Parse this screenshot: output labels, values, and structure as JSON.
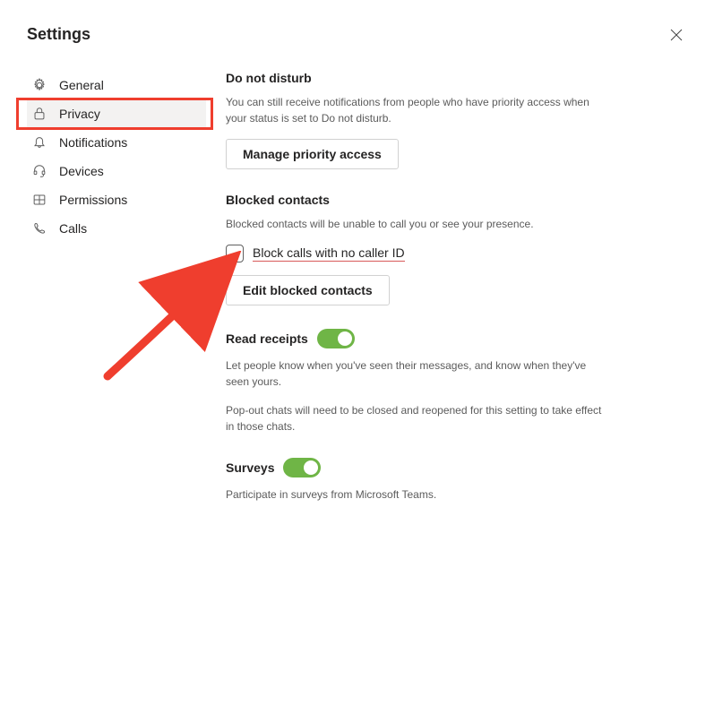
{
  "header": {
    "title": "Settings"
  },
  "sidebar": {
    "items": [
      {
        "label": "General",
        "icon": "gear"
      },
      {
        "label": "Privacy",
        "icon": "lock",
        "active": true
      },
      {
        "label": "Notifications",
        "icon": "bell"
      },
      {
        "label": "Devices",
        "icon": "headset"
      },
      {
        "label": "Permissions",
        "icon": "package"
      },
      {
        "label": "Calls",
        "icon": "phone"
      }
    ]
  },
  "content": {
    "dnd": {
      "title": "Do not disturb",
      "desc": "You can still receive notifications from people who have priority access when your status is set to Do not disturb.",
      "button": "Manage priority access"
    },
    "blocked": {
      "title": "Blocked contacts",
      "desc": "Blocked contacts will be unable to call you or see your presence.",
      "checkbox_label": "Block calls with no caller ID",
      "button": "Edit blocked contacts"
    },
    "read": {
      "title": "Read receipts",
      "desc1": "Let people know when you've seen their messages, and know when they've seen yours.",
      "desc2": "Pop-out chats will need to be closed and reopened for this setting to take effect in those chats."
    },
    "surveys": {
      "title": "Surveys",
      "desc": "Participate in surveys from Microsoft Teams."
    }
  },
  "annotations": {
    "highlight": "privacy-nav-item",
    "arrow_target": "block-no-caller-id-checkbox"
  }
}
